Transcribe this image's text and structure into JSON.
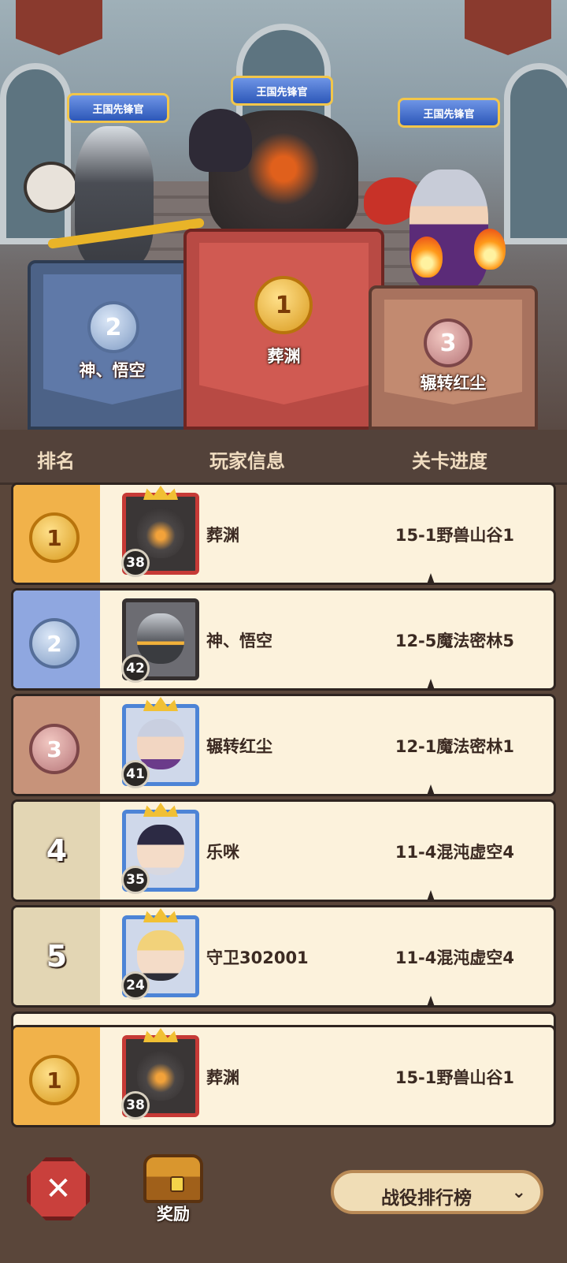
{
  "podium": {
    "title_badge": "王国先锋官",
    "first": {
      "rank": "1",
      "name": "葬渊"
    },
    "second": {
      "rank": "2",
      "name": "神、悟空"
    },
    "third": {
      "rank": "3",
      "name": "辗转红尘"
    }
  },
  "header": {
    "col_rank": "排名",
    "col_player": "玩家信息",
    "col_progress": "关卡进度"
  },
  "rows": [
    {
      "rank": "1",
      "level": "38",
      "name": "葬渊",
      "stage": "15-1野兽山谷1"
    },
    {
      "rank": "2",
      "level": "42",
      "name": "神、悟空",
      "stage": "12-5魔法密林5"
    },
    {
      "rank": "3",
      "level": "41",
      "name": "辗转红尘",
      "stage": "12-1魔法密林1"
    },
    {
      "rank": "4",
      "level": "35",
      "name": "乐咪",
      "stage": "11-4混沌虚空4"
    },
    {
      "rank": "5",
      "level": "24",
      "name": "守卫302001",
      "stage": "11-4混沌虚空4"
    }
  ],
  "my_row": {
    "rank": "1",
    "level": "38",
    "name": "葬渊",
    "stage": "15-1野兽山谷1"
  },
  "bottom": {
    "close_icon": "crossed-swords-icon",
    "reward_label": "奖励",
    "dropdown_label": "战役排行榜",
    "dropdown_icon": "chevron-down-icon"
  },
  "colors": {
    "gold": "#f1b24a",
    "silver": "#8fa7e0",
    "bronze": "#c7937a",
    "row_bg": "#fcf2dc"
  }
}
